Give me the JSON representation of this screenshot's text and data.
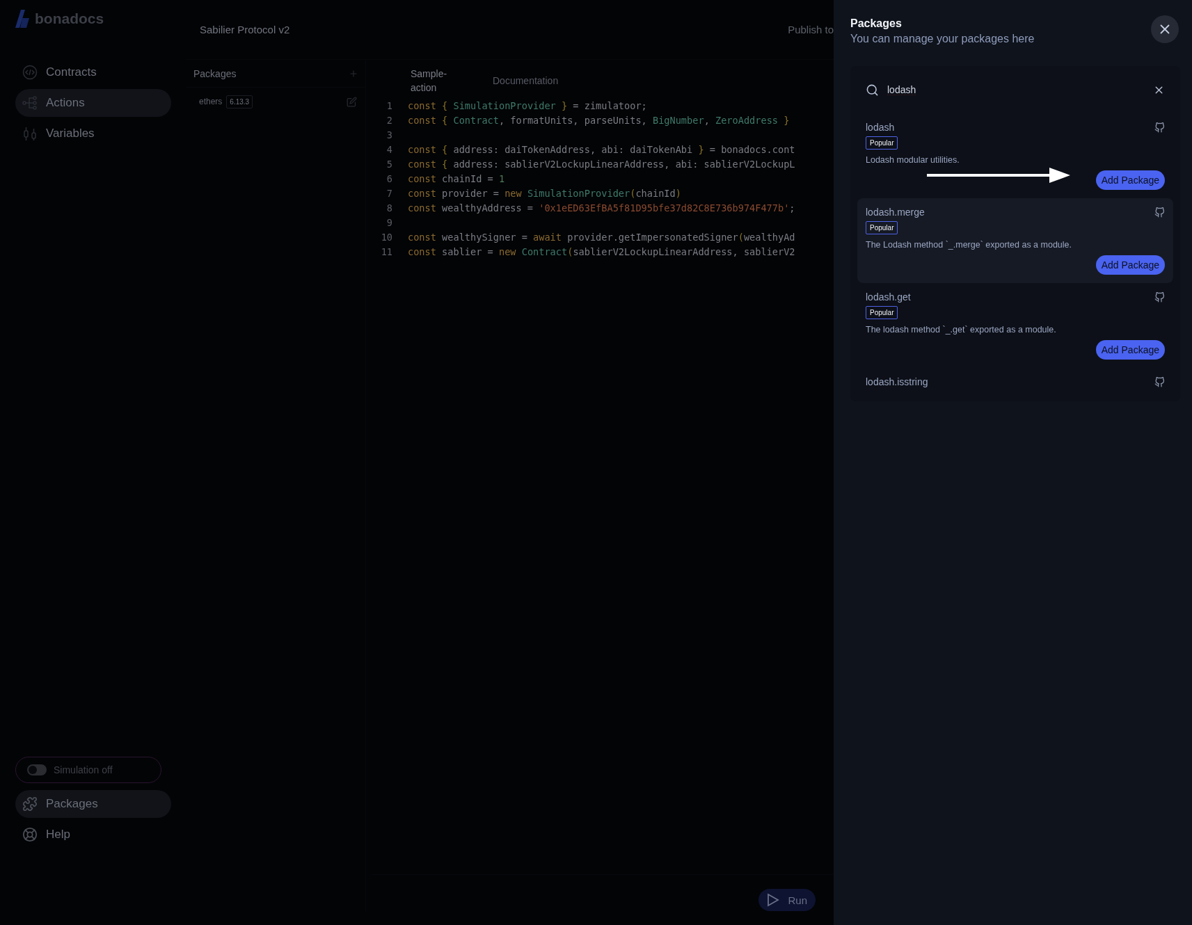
{
  "app": {
    "logo": "bonadocs",
    "title": "Sabilier Protocol v2",
    "publish": "Publish to"
  },
  "nav": [
    {
      "label": "Contracts",
      "selected": false
    },
    {
      "label": "Actions",
      "selected": true
    },
    {
      "label": "Variables",
      "selected": false
    }
  ],
  "simulation": {
    "label": "Simulation off",
    "on": false
  },
  "bottom_nav": [
    {
      "label": "Packages",
      "selected": true
    },
    {
      "label": "Help",
      "selected": false
    }
  ],
  "packages_panel": {
    "title": "Packages",
    "items": [
      {
        "name": "ethers",
        "version": "6.13.3"
      }
    ]
  },
  "editor": {
    "tabs": [
      {
        "label": "Sample-action",
        "selected": true
      },
      {
        "label": "Documentation",
        "selected": false
      }
    ],
    "lines": [
      {
        "number": "1",
        "tokens": [
          {
            "kind": "keyword",
            "text": "const"
          },
          {
            "kind": "brace",
            "text": " { "
          },
          {
            "kind": "type",
            "text": "SimulationProvider"
          },
          {
            "kind": "brace",
            "text": " }"
          },
          {
            "kind": "plain",
            "text": " = zimulatoor;"
          }
        ]
      },
      {
        "number": "2",
        "tokens": [
          {
            "kind": "keyword",
            "text": "const"
          },
          {
            "kind": "brace",
            "text": " { "
          },
          {
            "kind": "type",
            "text": "Contract"
          },
          {
            "kind": "plain",
            "text": ", formatUnits, parseUnits, "
          },
          {
            "kind": "type",
            "text": "BigNumber"
          },
          {
            "kind": "plain",
            "text": ", "
          },
          {
            "kind": "type",
            "text": "ZeroAddress"
          },
          {
            "kind": "brace",
            "text": " }"
          }
        ]
      },
      {
        "number": "3"
      },
      {
        "number": "4",
        "tokens": [
          {
            "kind": "keyword",
            "text": "const"
          },
          {
            "kind": "brace",
            "text": " { "
          },
          {
            "kind": "plain",
            "text": "address: daiTokenAddress, abi: daiTokenAbi "
          },
          {
            "kind": "brace",
            "text": "}"
          },
          {
            "kind": "plain",
            "text": " = bonadocs.cont"
          }
        ]
      },
      {
        "number": "5",
        "tokens": [
          {
            "kind": "keyword",
            "text": "const"
          },
          {
            "kind": "brace",
            "text": " { "
          },
          {
            "kind": "plain",
            "text": "address: sablierV2LockupLinearAddress, abi: sablierV2LockupL"
          }
        ]
      },
      {
        "number": "6",
        "tokens": [
          {
            "kind": "keyword",
            "text": "const"
          },
          {
            "kind": "plain",
            "text": " chainId = "
          },
          {
            "kind": "number",
            "text": "1"
          }
        ]
      },
      {
        "number": "7",
        "tokens": [
          {
            "kind": "keyword",
            "text": "const"
          },
          {
            "kind": "plain",
            "text": " provider = "
          },
          {
            "kind": "keyword",
            "text": "new"
          },
          {
            "kind": "type",
            "text": " SimulationProvider"
          },
          {
            "kind": "brace",
            "text": "("
          },
          {
            "kind": "plain",
            "text": "chainId"
          },
          {
            "kind": "brace",
            "text": ")"
          }
        ]
      },
      {
        "number": "8",
        "tokens": [
          {
            "kind": "keyword",
            "text": "const"
          },
          {
            "kind": "plain",
            "text": " wealthyAddress = "
          },
          {
            "kind": "string",
            "text": "'0x1eED63EfBA5f81D95bfe37d82C8E736b974F477b'"
          },
          {
            "kind": "plain",
            "text": ";"
          }
        ]
      },
      {
        "number": "9"
      },
      {
        "number": "10",
        "tokens": [
          {
            "kind": "keyword",
            "text": "const"
          },
          {
            "kind": "plain",
            "text": " wealthySigner = "
          },
          {
            "kind": "keyword",
            "text": "await"
          },
          {
            "kind": "plain",
            "text": " provider.getImpersonatedSigner"
          },
          {
            "kind": "brace",
            "text": "("
          },
          {
            "kind": "plain",
            "text": "wealthyAd"
          }
        ]
      },
      {
        "number": "11",
        "tokens": [
          {
            "kind": "keyword",
            "text": "const"
          },
          {
            "kind": "plain",
            "text": " sablier = "
          },
          {
            "kind": "keyword",
            "text": "new"
          },
          {
            "kind": "type",
            "text": " Contract"
          },
          {
            "kind": "brace",
            "text": "("
          },
          {
            "kind": "plain",
            "text": "sablierV2LockupLinearAddress, sablierV2"
          }
        ]
      }
    ],
    "run": "Run"
  },
  "drawer": {
    "title": "Packages",
    "subtitle": "You can manage your packages here",
    "search": {
      "value": "lodash"
    },
    "results": [
      {
        "name": "lodash",
        "badge": "Popular",
        "description": "Lodash modular utilities.",
        "button": "Add Package",
        "highlighted": false
      },
      {
        "name": "lodash.merge",
        "badge": "Popular",
        "description": "The Lodash method `_.merge` exported as a module.",
        "button": "Add Package",
        "highlighted": true
      },
      {
        "name": "lodash.get",
        "badge": "Popular",
        "description": "The lodash method `_.get` exported as a module.",
        "button": "Add Package",
        "highlighted": false
      },
      {
        "name": "lodash.isstring",
        "highlighted": false
      }
    ]
  }
}
